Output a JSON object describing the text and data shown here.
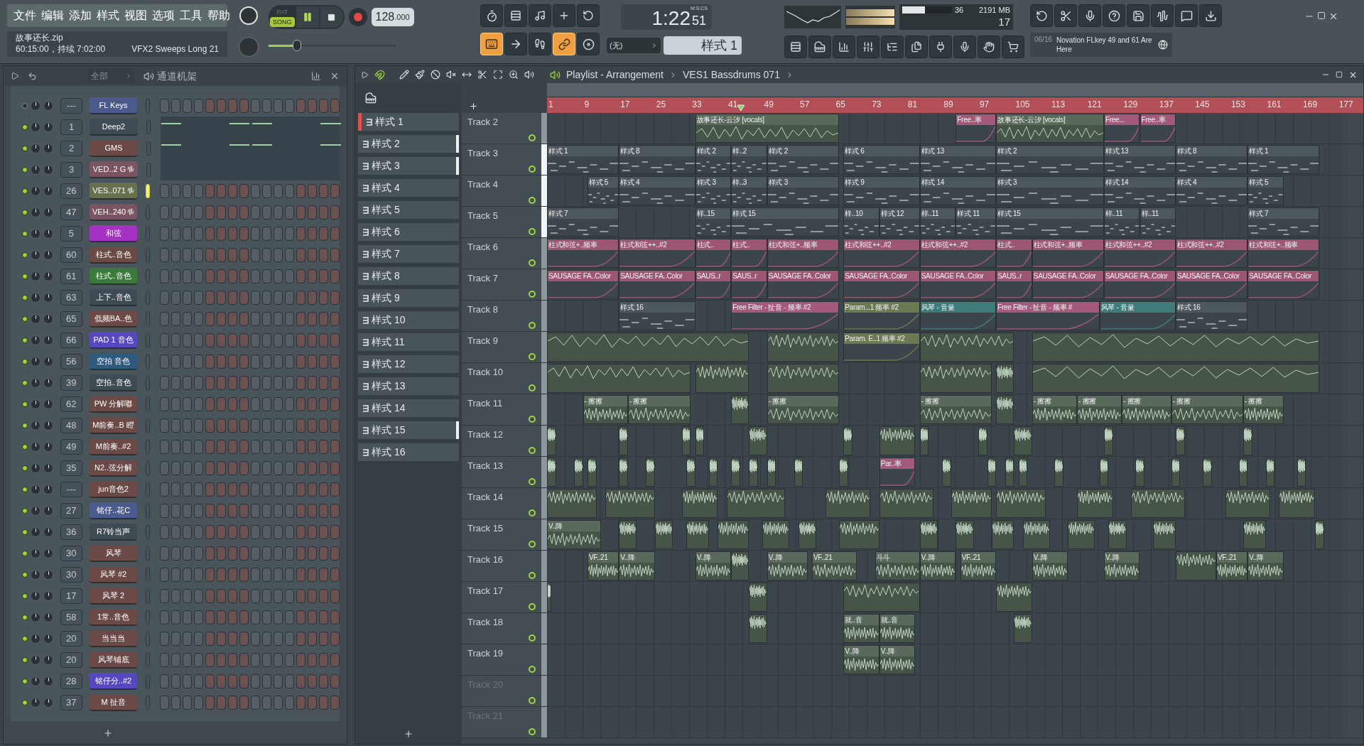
{
  "menu": [
    "文件",
    "编辑",
    "添加",
    "样式",
    "视图",
    "选项",
    "工具",
    "帮助"
  ],
  "transport": {
    "modes": [
      {
        "label": "PAT",
        "selected": false
      },
      {
        "label": "SONG",
        "selected": true
      }
    ],
    "playing": true,
    "tempo": "128",
    "tempo_fraction": ".000",
    "time_main": "1:22",
    "time_cs": "51",
    "time_unit": "M:S:CS"
  },
  "info": {
    "file": "故事还长.zip",
    "detail": "60:15:00，持续 7:02:00",
    "hint": "VFX2 Sweeps Long 21"
  },
  "master": {
    "level": 0.22
  },
  "cpu": {
    "level": 0.45,
    "value": "36",
    "memory": "2191 MB",
    "polyphony": "17"
  },
  "mode_buttons": [
    {
      "on": true
    },
    {
      "on": false
    },
    {
      "on": false
    },
    {
      "on": true
    },
    {
      "on": false
    }
  ],
  "midi_input": "(无)",
  "pattern_selector": "样式 1",
  "news": {
    "date": "06/16",
    "text": "Novation FLkey 49 and 61 Are Here"
  },
  "channel_rack": {
    "filter": "全部",
    "title": "通道机架",
    "channels": [
      {
        "number": "---",
        "name": "FL Keys",
        "color": "#4b5b8e",
        "on": false,
        "selected": false,
        "wave": false,
        "kind": "steps"
      },
      {
        "number": "1",
        "name": "Deep2",
        "color": "#3f4b53",
        "on": true,
        "selected": false,
        "wave": false,
        "kind": "notes"
      },
      {
        "number": "2",
        "name": "GMS",
        "color": "#6a4946",
        "on": true,
        "selected": false,
        "wave": false,
        "kind": "notes"
      },
      {
        "number": "3",
        "name": "VED..2 G",
        "color": "#7a5561",
        "on": true,
        "selected": false,
        "wave": true,
        "kind": "empty"
      },
      {
        "number": "26",
        "name": "VES..071",
        "color": "#66704f",
        "on": true,
        "selected": true,
        "wave": true,
        "kind": "steps"
      },
      {
        "number": "47",
        "name": "VEH..240",
        "color": "#7a5561",
        "on": true,
        "selected": false,
        "wave": true,
        "kind": "steps"
      },
      {
        "number": "5",
        "name": "和弦",
        "color": "#a632c4",
        "on": true,
        "selected": false,
        "wave": false,
        "kind": "steps"
      },
      {
        "number": "60",
        "name": "柱式..音色",
        "color": "#6a4946",
        "on": true,
        "selected": false,
        "wave": false,
        "kind": "steps"
      },
      {
        "number": "61",
        "name": "柱式..音色",
        "color": "#3b7a3a",
        "on": true,
        "selected": false,
        "wave": false,
        "kind": "steps"
      },
      {
        "number": "63",
        "name": "上下..音色",
        "color": "#3f4b53",
        "on": true,
        "selected": false,
        "wave": false,
        "kind": "steps"
      },
      {
        "number": "65",
        "name": "低频BA..色",
        "color": "#6a4946",
        "on": true,
        "selected": false,
        "wave": false,
        "kind": "steps"
      },
      {
        "number": "66",
        "name": "PAD 1 音色",
        "color": "#5848c0",
        "on": true,
        "selected": false,
        "wave": false,
        "kind": "steps"
      },
      {
        "number": "56",
        "name": "空拍 音色",
        "color": "#2f5a80",
        "on": true,
        "selected": false,
        "wave": false,
        "kind": "steps"
      },
      {
        "number": "39",
        "name": "空拍..音色",
        "color": "#3f4b53",
        "on": true,
        "selected": false,
        "wave": false,
        "kind": "steps"
      },
      {
        "number": "62",
        "name": "PW 分解嘟",
        "color": "#6a4946",
        "on": true,
        "selected": false,
        "wave": false,
        "kind": "steps"
      },
      {
        "number": "48",
        "name": "M前奏..B 瞪",
        "color": "#6a4946",
        "on": true,
        "selected": false,
        "wave": false,
        "kind": "steps"
      },
      {
        "number": "49",
        "name": "M前奏..#2",
        "color": "#6a4946",
        "on": true,
        "selected": false,
        "wave": false,
        "kind": "steps"
      },
      {
        "number": "35",
        "name": "N2..弦分解",
        "color": "#6a4946",
        "on": true,
        "selected": false,
        "wave": false,
        "kind": "steps"
      },
      {
        "number": "---",
        "name": "jun音色2",
        "color": "#6a4946",
        "on": true,
        "selected": false,
        "wave": false,
        "kind": "steps"
      },
      {
        "number": "27",
        "name": "铭仔..花C",
        "color": "#4b5b8e",
        "on": true,
        "selected": false,
        "wave": false,
        "kind": "steps"
      },
      {
        "number": "36",
        "name": "R7铃当声",
        "color": "#3f4b53",
        "on": true,
        "selected": false,
        "wave": false,
        "kind": "steps"
      },
      {
        "number": "30",
        "name": "风琴",
        "color": "#6a4946",
        "on": true,
        "selected": false,
        "wave": false,
        "kind": "steps"
      },
      {
        "number": "30",
        "name": "风琴 #2",
        "color": "#6a4946",
        "on": true,
        "selected": false,
        "wave": false,
        "kind": "steps"
      },
      {
        "number": "17",
        "name": "风琴 2",
        "color": "#6a4946",
        "on": true,
        "selected": false,
        "wave": false,
        "kind": "steps"
      },
      {
        "number": "58",
        "name": "1常..音色",
        "color": "#6a4946",
        "on": true,
        "selected": false,
        "wave": false,
        "kind": "steps"
      },
      {
        "number": "20",
        "name": "当当当",
        "color": "#6a4946",
        "on": true,
        "selected": false,
        "wave": false,
        "kind": "steps"
      },
      {
        "number": "20",
        "name": "风琴铺底",
        "color": "#6a4946",
        "on": true,
        "selected": false,
        "wave": false,
        "kind": "steps"
      },
      {
        "number": "28",
        "name": "铭仔分..#2",
        "color": "#5848c0",
        "on": true,
        "selected": false,
        "wave": false,
        "kind": "steps"
      },
      {
        "number": "37",
        "name": "M 扯音",
        "color": "#6a4946",
        "on": true,
        "selected": false,
        "wave": false,
        "kind": "steps"
      }
    ]
  },
  "patterns": [
    {
      "label": "样式 1",
      "selected": true,
      "flag": false
    },
    {
      "label": "样式 2",
      "selected": false,
      "flag": true
    },
    {
      "label": "样式 3",
      "selected": false,
      "flag": true
    },
    {
      "label": "样式 4",
      "selected": false,
      "flag": false
    },
    {
      "label": "样式 5",
      "selected": false,
      "flag": false
    },
    {
      "label": "样式 6",
      "selected": false,
      "flag": false
    },
    {
      "label": "样式 7",
      "selected": false,
      "flag": false
    },
    {
      "label": "样式 8",
      "selected": false,
      "flag": false
    },
    {
      "label": "样式 9",
      "selected": false,
      "flag": false
    },
    {
      "label": "样式 10",
      "selected": false,
      "flag": false
    },
    {
      "label": "样式 11",
      "selected": false,
      "flag": false
    },
    {
      "label": "样式 12",
      "selected": false,
      "flag": false
    },
    {
      "label": "样式 13",
      "selected": false,
      "flag": false
    },
    {
      "label": "样式 14",
      "selected": false,
      "flag": false
    },
    {
      "label": "样式 15",
      "selected": false,
      "flag": true
    },
    {
      "label": "样式 16",
      "selected": false,
      "flag": false
    }
  ],
  "playlist": {
    "title": "Playlist - Arrangement",
    "current": "VES1 Bassdrums 071",
    "ruler": [
      "1",
      "9",
      "17",
      "25",
      "33",
      "41",
      "49",
      "57",
      "65",
      "73",
      "81",
      "89",
      "97",
      "105",
      "113",
      "121",
      "129",
      "137",
      "145",
      "153",
      "161",
      "169",
      "177"
    ],
    "playhead": {
      "level": 0.244
    },
    "tracks": [
      {
        "name": "Track 2",
        "selected": false,
        "dimmed": false,
        "clips": [
          {
            "kind": "audio",
            "label": "故事还长-云汐 [vocals]"
          },
          {
            "kind": "automation",
            "label": "Free..率",
            "color": "#a35a7a"
          },
          {
            "kind": "audio",
            "label": "故事还长-云汐 [vocals]"
          },
          {
            "kind": "automation",
            "label": "Free...",
            "color": "#a35a7a"
          },
          {
            "kind": "automation",
            "label": "Free..率",
            "color": "#a35a7a"
          }
        ]
      },
      {
        "name": "Track 3",
        "selected": true,
        "dimmed": false,
        "clips": [
          {
            "kind": "pattern",
            "label": "样式 1"
          },
          {
            "kind": "pattern",
            "label": "样式 8"
          },
          {
            "kind": "pattern",
            "label": "样式 2"
          },
          {
            "kind": "pattern",
            "label": "样..2"
          },
          {
            "kind": "pattern",
            "label": "样式 2"
          },
          {
            "kind": "pattern",
            "label": "样式 6"
          },
          {
            "kind": "pattern",
            "label": "样式 13"
          },
          {
            "kind": "pattern",
            "label": "样式 2"
          },
          {
            "kind": "pattern",
            "label": "样式 13"
          },
          {
            "kind": "pattern",
            "label": "样式 8"
          },
          {
            "kind": "pattern",
            "label": "样式 1"
          }
        ]
      },
      {
        "name": "Track 4",
        "selected": true,
        "dimmed": false,
        "clips": [
          {
            "kind": "pattern",
            "label": "样式 5"
          },
          {
            "kind": "pattern",
            "label": "样式 4"
          },
          {
            "kind": "pattern",
            "label": "样式 3"
          },
          {
            "kind": "pattern",
            "label": "样..3"
          },
          {
            "kind": "pattern",
            "label": "样式 3"
          },
          {
            "kind": "pattern",
            "label": "样式 9"
          },
          {
            "kind": "pattern",
            "label": "样式 14"
          },
          {
            "kind": "pattern",
            "label": "样式 3"
          },
          {
            "kind": "pattern",
            "label": "样式 14"
          },
          {
            "kind": "pattern",
            "label": "样式 4"
          },
          {
            "kind": "pattern",
            "label": "样式 5"
          }
        ]
      },
      {
        "name": "Track 5",
        "selected": true,
        "dimmed": false,
        "clips": [
          {
            "kind": "pattern",
            "label": "样式 7"
          },
          {
            "kind": "pattern",
            "label": "样..15"
          },
          {
            "kind": "pattern",
            "label": "样式 15"
          },
          {
            "kind": "pattern",
            "label": "样..10"
          },
          {
            "kind": "pattern",
            "label": "样式 12"
          },
          {
            "kind": "pattern",
            "label": "样..11"
          },
          {
            "kind": "pattern",
            "label": "样式 11"
          },
          {
            "kind": "pattern",
            "label": "样式 15"
          },
          {
            "kind": "pattern",
            "label": "样..11"
          },
          {
            "kind": "pattern",
            "label": "样..11"
          },
          {
            "kind": "pattern",
            "label": "样式 7"
          }
        ]
      },
      {
        "name": "Track 6",
        "selected": false,
        "dimmed": false,
        "clips": [
          {
            "kind": "automation",
            "label": "柱式和弦+..频率",
            "color": "#9c5572"
          },
          {
            "kind": "automation",
            "label": "柱式和弦++..#2",
            "color": "#9c5572"
          },
          {
            "kind": "automation",
            "label": "柱式..",
            "color": "#9c5572"
          },
          {
            "kind": "automation",
            "label": "柱式..",
            "color": "#9c5572"
          },
          {
            "kind": "automation",
            "label": "柱式和弦+..频率",
            "color": "#9c5572"
          },
          {
            "kind": "automation",
            "label": "柱式和弦++..#2",
            "color": "#9c5572"
          },
          {
            "kind": "automation",
            "label": "柱式和弦++..#2",
            "color": "#9c5572"
          },
          {
            "kind": "automation",
            "label": "柱式..",
            "color": "#9c5572"
          },
          {
            "kind": "automation",
            "label": "柱式和弦+..频率",
            "color": "#9c5572"
          },
          {
            "kind": "automation",
            "label": "柱式和弦++..#2",
            "color": "#9c5572"
          },
          {
            "kind": "automation",
            "label": "柱式和弦++..#2",
            "color": "#9c5572"
          },
          {
            "kind": "automation",
            "label": "柱式和弦+..频率",
            "color": "#9c5572"
          }
        ]
      },
      {
        "name": "Track 7",
        "selected": false,
        "dimmed": false,
        "clips": [
          {
            "kind": "automation",
            "label": "SAUSAGE FA..Color",
            "color": "#9c5572"
          },
          {
            "kind": "automation",
            "label": "SAUSAGE FA..Color",
            "color": "#9c5572"
          },
          {
            "kind": "automation",
            "label": "SAUS..r",
            "color": "#9c5572"
          },
          {
            "kind": "automation",
            "label": "SAUS..r",
            "color": "#9c5572"
          },
          {
            "kind": "automation",
            "label": "SAUSAGE FA..Color",
            "color": "#9c5572"
          },
          {
            "kind": "automation",
            "label": "SAUSAGE FA..Color",
            "color": "#9c5572"
          },
          {
            "kind": "automation",
            "label": "SAUSAGE FA..Color",
            "color": "#9c5572"
          },
          {
            "kind": "automation",
            "label": "SAUS..r",
            "color": "#9c5572"
          },
          {
            "kind": "automation",
            "label": "SAUSAGE FA..Color",
            "color": "#9c5572"
          },
          {
            "kind": "automation",
            "label": "SAUSAGE FA..Color",
            "color": "#9c5572"
          },
          {
            "kind": "automation",
            "label": "SAUSAGE FA..Color",
            "color": "#9c5572"
          },
          {
            "kind": "automation",
            "label": "SAUSAGE FA..Color",
            "color": "#9c5572"
          }
        ]
      },
      {
        "name": "Track 8",
        "selected": false,
        "dimmed": false,
        "clips": [
          {
            "kind": "pattern",
            "label": "样式 16"
          },
          {
            "kind": "automation",
            "label": "Free Filter - 扯音 - 频率 #2",
            "color": "#a35a7a"
          },
          {
            "kind": "automation",
            "label": "Param...1 频率 #2",
            "color": "#6b7a52"
          },
          {
            "kind": "automation",
            "label": "风琴 - 音量",
            "color": "#3f7b78"
          },
          {
            "kind": "automation",
            "label": "Free Filter - 扯音 - 频率 #",
            "color": "#a35a7a"
          },
          {
            "kind": "automation",
            "label": "风琴 - 音量",
            "color": "#3f7b78"
          },
          {
            "kind": "pattern",
            "label": "样式 16"
          }
        ]
      },
      {
        "name": "Track 9",
        "selected": false,
        "dimmed": false,
        "clips": [
          {
            "kind": "audio"
          },
          {
            "kind": "audio"
          },
          {
            "kind": "automation",
            "label": "Param. E..1 频率 #2",
            "color": "#6b7a52"
          },
          {
            "kind": "audio"
          },
          {
            "kind": "audio"
          }
        ]
      },
      {
        "name": "Track 10",
        "selected": false,
        "dimmed": false,
        "clips": [
          {
            "kind": "audio"
          },
          {
            "kind": "audio"
          },
          {
            "kind": "audio"
          },
          {
            "kind": "audio"
          },
          {
            "kind": "audio"
          },
          {
            "kind": "audio"
          }
        ]
      },
      {
        "name": "Track 11",
        "selected": false,
        "dimmed": false,
        "clips": [
          {
            "kind": "audio",
            "label": "- 擦擦"
          },
          {
            "kind": "audio",
            "label": "- 擦擦"
          },
          {
            "kind": "audio"
          },
          {
            "kind": "audio",
            "label": "- 擦擦"
          },
          {
            "kind": "audio",
            "label": "- 擦擦"
          },
          {
            "kind": "audio"
          },
          {
            "kind": "audio",
            "label": "- 擦擦"
          },
          {
            "kind": "audio",
            "label": "- 擦擦"
          },
          {
            "kind": "audio",
            "label": "- 擦擦"
          },
          {
            "kind": "audio",
            "label": "- 擦擦"
          },
          {
            "kind": "audio",
            "label": "- 擦擦"
          }
        ]
      },
      {
        "name": "Track 12",
        "selected": false,
        "dimmed": false,
        "clips": [
          {
            "kind": "audio"
          },
          {
            "kind": "audio"
          },
          {
            "kind": "audio"
          },
          {
            "kind": "audio"
          },
          {
            "kind": "audio"
          },
          {
            "kind": "audio"
          },
          {
            "kind": "audio"
          },
          {
            "kind": "audio"
          },
          {
            "kind": "audio"
          },
          {
            "kind": "audio"
          },
          {
            "kind": "audio"
          },
          {
            "kind": "audio"
          },
          {
            "kind": "audio"
          }
        ]
      },
      {
        "name": "Track 13",
        "selected": false,
        "dimmed": false,
        "clips": [
          {
            "kind": "audio"
          },
          {
            "kind": "audio"
          },
          {
            "kind": "audio"
          },
          {
            "kind": "audio"
          },
          {
            "kind": "audio"
          },
          {
            "kind": "audio"
          },
          {
            "kind": "audio"
          },
          {
            "kind": "audio"
          },
          {
            "kind": "audio"
          },
          {
            "kind": "audio"
          },
          {
            "kind": "audio"
          },
          {
            "kind": "audio"
          },
          {
            "kind": "automation",
            "label": "Par..率",
            "color": "#a35a7a"
          },
          {
            "kind": "audio"
          },
          {
            "kind": "audio"
          },
          {
            "kind": "audio"
          },
          {
            "kind": "audio"
          },
          {
            "kind": "audio"
          },
          {
            "kind": "audio"
          },
          {
            "kind": "audio"
          },
          {
            "kind": "audio"
          },
          {
            "kind": "audio"
          },
          {
            "kind": "audio"
          },
          {
            "kind": "audio"
          },
          {
            "kind": "audio"
          }
        ]
      },
      {
        "name": "Track 14",
        "selected": false,
        "dimmed": false,
        "clips": [
          {
            "kind": "audio"
          },
          {
            "kind": "audio"
          },
          {
            "kind": "audio"
          },
          {
            "kind": "audio"
          },
          {
            "kind": "audio"
          },
          {
            "kind": "audio"
          },
          {
            "kind": "audio"
          },
          {
            "kind": "audio"
          },
          {
            "kind": "audio"
          },
          {
            "kind": "audio"
          },
          {
            "kind": "audio"
          },
          {
            "kind": "audio"
          }
        ]
      },
      {
        "name": "Track 15",
        "selected": false,
        "dimmed": false,
        "clips": [
          {
            "kind": "audio",
            "label": "V..降"
          },
          {
            "kind": "audio"
          },
          {
            "kind": "audio"
          },
          {
            "kind": "audio"
          },
          {
            "kind": "audio"
          },
          {
            "kind": "audio"
          },
          {
            "kind": "audio"
          },
          {
            "kind": "audio"
          },
          {
            "kind": "audio"
          },
          {
            "kind": "audio"
          },
          {
            "kind": "audio"
          },
          {
            "kind": "audio"
          },
          {
            "kind": "audio"
          },
          {
            "kind": "audio"
          },
          {
            "kind": "audio"
          },
          {
            "kind": "audio"
          },
          {
            "kind": "audio"
          }
        ]
      },
      {
        "name": "Track 16",
        "selected": false,
        "dimmed": false,
        "clips": [
          {
            "kind": "audio",
            "label": "VF..21"
          },
          {
            "kind": "audio",
            "label": "V..降"
          },
          {
            "kind": "audio",
            "label": "V..降"
          },
          {
            "kind": "audio"
          },
          {
            "kind": "audio",
            "label": "V..降"
          },
          {
            "kind": "audio",
            "label": "VF..21"
          },
          {
            "kind": "audio",
            "label": "斗斗"
          },
          {
            "kind": "audio",
            "label": "V..降"
          },
          {
            "kind": "audio",
            "label": "VF..21"
          },
          {
            "kind": "audio",
            "label": "V..降"
          },
          {
            "kind": "audio",
            "label": "V..降"
          },
          {
            "kind": "audio"
          },
          {
            "kind": "audio",
            "label": "VF..21"
          },
          {
            "kind": "audio",
            "label": "V..降"
          }
        ]
      },
      {
        "name": "Track 17",
        "selected": false,
        "dimmed": false,
        "clips": [
          {
            "kind": "audio"
          },
          {
            "kind": "audio"
          },
          {
            "kind": "audio"
          },
          {
            "kind": "audio"
          }
        ]
      },
      {
        "name": "Track 18",
        "selected": false,
        "dimmed": false,
        "clips": [
          {
            "kind": "audio"
          },
          {
            "kind": "audio",
            "label": "就..音"
          },
          {
            "kind": "audio",
            "label": "就..音"
          },
          {
            "kind": "audio"
          }
        ]
      },
      {
        "name": "Track 19",
        "selected": false,
        "dimmed": false,
        "clips": [
          {
            "kind": "audio",
            "label": "V..降"
          },
          {
            "kind": "audio",
            "label": "V..降"
          }
        ]
      },
      {
        "name": "Track 20",
        "selected": false,
        "dimmed": true
      },
      {
        "name": "Track 21",
        "selected": false,
        "dimmed": true
      }
    ]
  }
}
